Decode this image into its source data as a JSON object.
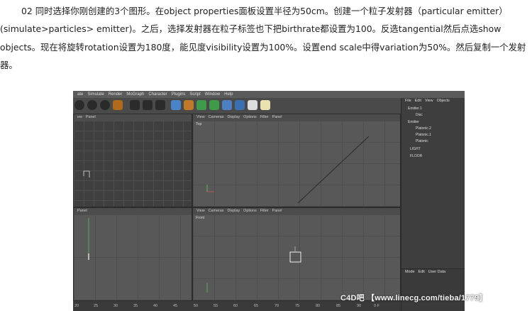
{
  "article": {
    "paragraph": "02 同时选择你刚创建的3个图形。在object properties面板设置半径为50cm。创建一个粒子发射器（particular emitter）(simulate>particles> emitter)。之后，选择发射器在粒子标签也下把birthrate都设置为100。反选tangential然后点选show objects。现在将旋转rotation设置为180度，能见度visibility设置为100%。设置end scale中得variation为50%。然后复制一个发射器。"
  },
  "menu": [
    "ate",
    "Simulate",
    "Render",
    "MoGraph",
    "Character",
    "Plugins",
    "Script",
    "Window",
    "Help"
  ],
  "viewports": {
    "top_left": {
      "tabs": [
        "ew",
        "Panel"
      ]
    },
    "top_right": {
      "tabs": [
        "View",
        "Cameras",
        "Display",
        "Options",
        "Filter",
        "Panel"
      ],
      "label": "Top"
    },
    "bottom_left": {
      "tabs": [
        "Panel"
      ]
    },
    "bottom_right": {
      "tabs": [
        "View",
        "Cameras",
        "Display",
        "Options",
        "Filter",
        "Panel"
      ],
      "label": "Front"
    }
  },
  "object_manager": {
    "tabs": [
      "File",
      "Edit",
      "View",
      "Objects"
    ],
    "items": [
      "Emitter.1",
      "Disc",
      "Emitter",
      "Platonic.2",
      "Platonic.1",
      "Platonic",
      "LIGHT",
      "FLOOR"
    ],
    "attr_tabs": [
      "Mode",
      "Edit",
      "User Data"
    ]
  },
  "timeline": {
    "ticks": [
      "20",
      "25",
      "30",
      "35",
      "40",
      "45",
      "50",
      "55",
      "60",
      "65",
      "70",
      "75",
      "80",
      "85",
      "90",
      "0 F"
    ]
  },
  "watermark": "C4D吧 【www.linecg.com/tieba/1779】"
}
